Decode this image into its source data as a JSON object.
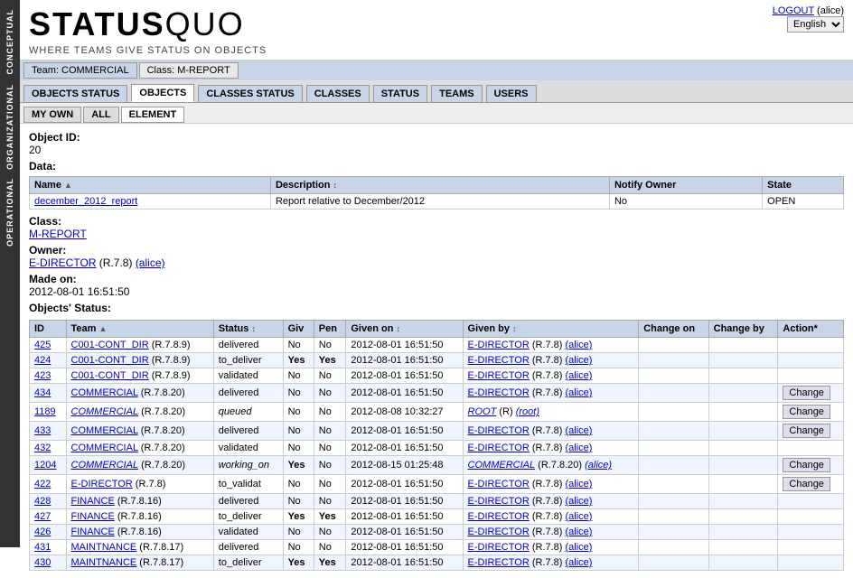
{
  "sidebar": {
    "labels": [
      "CONCEPTUAL",
      "ORGANIZATIONAL",
      "OPERATIONAL"
    ]
  },
  "header": {
    "logo_status": "STATUS",
    "logo_quo": "QUO",
    "tagline": "WHERE TEAMS GIVE STATUS ON OBJECTS",
    "logout_text": "LOGOUT",
    "logout_user": "(alice)",
    "lang_options": [
      "English"
    ],
    "lang_selected": "English"
  },
  "team_class_bar": {
    "team_label": "Team: COMMERCIAL",
    "class_label": "Class: M-REPORT"
  },
  "nav_tabs": [
    {
      "label": "OBJECTS STATUS",
      "active": false
    },
    {
      "label": "OBJECTS",
      "active": true
    },
    {
      "label": "CLASSES STATUS",
      "active": false
    },
    {
      "label": "CLASSES",
      "active": false
    },
    {
      "label": "STATUS",
      "active": false
    },
    {
      "label": "TEAMS",
      "active": false
    },
    {
      "label": "USERS",
      "active": false
    }
  ],
  "sub_tabs": [
    {
      "label": "MY OWN",
      "active": false
    },
    {
      "label": "ALL",
      "active": false
    },
    {
      "label": "ELEMENT",
      "active": true
    }
  ],
  "object": {
    "id_label": "Object ID:",
    "id_value": "20",
    "data_label": "Data:",
    "table_headers": [
      "Name",
      "Description",
      "Notify Owner",
      "State"
    ],
    "table_rows": [
      {
        "name": "december_2012_report",
        "description": "Report relative to December/2012",
        "notify_owner": "No",
        "state": "OPEN"
      }
    ],
    "class_label": "Class:",
    "class_value": "M-REPORT",
    "owner_label": "Owner:",
    "owner_value": "E-DIRECTOR",
    "owner_version": "(R.7.8)",
    "owner_user": "(alice)",
    "made_on_label": "Made on:",
    "made_on_value": "2012-08-01 16:51:50",
    "objects_status_label": "Objects' Status:"
  },
  "status_table": {
    "headers": [
      "ID",
      "Team",
      "Status",
      "Giv",
      "Pen",
      "Given on",
      "Given by",
      "Change on",
      "Change by",
      "Action*"
    ],
    "rows": [
      {
        "id": "425",
        "team": "C001-CONT_DIR",
        "team_version": "(R.7.8.9)",
        "status": "delivered",
        "giv": "No",
        "pen": "No",
        "given_on": "2012-08-01 16:51:50",
        "given_by": "E-DIRECTOR",
        "given_by_version": "(R.7.8)",
        "given_by_user": "(alice)",
        "change_on": "",
        "change_by": "",
        "action": "",
        "italic": false
      },
      {
        "id": "424",
        "team": "C001-CONT_DIR",
        "team_version": "(R.7.8.9)",
        "status": "to_deliver",
        "giv": "Yes",
        "pen": "Yes",
        "given_on": "2012-08-01 16:51:50",
        "given_by": "E-DIRECTOR",
        "given_by_version": "(R.7.8)",
        "given_by_user": "(alice)",
        "change_on": "",
        "change_by": "",
        "action": "",
        "italic": false
      },
      {
        "id": "423",
        "team": "C001-CONT_DIR",
        "team_version": "(R.7.8.9)",
        "status": "validated",
        "giv": "No",
        "pen": "No",
        "given_on": "2012-08-01 16:51:50",
        "given_by": "E-DIRECTOR",
        "given_by_version": "(R.7.8)",
        "given_by_user": "(alice)",
        "change_on": "",
        "change_by": "",
        "action": "",
        "italic": false
      },
      {
        "id": "434",
        "team": "COMMERCIAL",
        "team_version": "(R.7.8.20)",
        "status": "delivered",
        "giv": "No",
        "pen": "No",
        "given_on": "2012-08-01 16:51:50",
        "given_by": "E-DIRECTOR",
        "given_by_version": "(R.7.8)",
        "given_by_user": "(alice)",
        "change_on": "",
        "change_by": "",
        "action": "Change",
        "italic": false
      },
      {
        "id": "1189",
        "team": "COMMERCIAL",
        "team_version": "(R.7.8.20)",
        "status": "queued",
        "giv": "No",
        "pen": "No",
        "given_on": "2012-08-08 10:32:27",
        "given_by": "ROOT",
        "given_by_version": "(R)",
        "given_by_user": "(root)",
        "change_on": "",
        "change_by": "",
        "action": "Change",
        "italic": true
      },
      {
        "id": "433",
        "team": "COMMERCIAL",
        "team_version": "(R.7.8.20)",
        "status": "delivered",
        "giv": "No",
        "pen": "No",
        "given_on": "2012-08-01 16:51:50",
        "given_by": "E-DIRECTOR",
        "given_by_version": "(R.7.8)",
        "given_by_user": "(alice)",
        "change_on": "",
        "change_by": "",
        "action": "Change",
        "italic": false
      },
      {
        "id": "432",
        "team": "COMMERCIAL",
        "team_version": "(R.7.8.20)",
        "status": "validated",
        "giv": "No",
        "pen": "No",
        "given_on": "2012-08-01 16:51:50",
        "given_by": "E-DIRECTOR",
        "given_by_version": "(R.7.8)",
        "given_by_user": "(alice)",
        "change_on": "",
        "change_by": "",
        "action": "",
        "italic": false
      },
      {
        "id": "1204",
        "team": "COMMERCIAL",
        "team_version": "(R.7.8.20)",
        "status": "working_on",
        "giv": "Yes",
        "pen": "No",
        "given_on": "2012-08-15 01:25:48",
        "given_by": "COMMERCIAL",
        "given_by_version": "(R.7.8.20)",
        "given_by_user": "(alice)",
        "change_on": "",
        "change_by": "",
        "action": "Change",
        "italic": true
      },
      {
        "id": "422",
        "team": "E-DIRECTOR",
        "team_version": "(R.7.8)",
        "status": "to_validat",
        "giv": "No",
        "pen": "No",
        "given_on": "2012-08-01 16:51:50",
        "given_by": "E-DIRECTOR",
        "given_by_version": "(R.7.8)",
        "given_by_user": "(alice)",
        "change_on": "",
        "change_by": "",
        "action": "Change",
        "italic": false
      },
      {
        "id": "428",
        "team": "FINANCE",
        "team_version": "(R.7.8.16)",
        "status": "delivered",
        "giv": "No",
        "pen": "No",
        "given_on": "2012-08-01 16:51:50",
        "given_by": "E-DIRECTOR",
        "given_by_version": "(R.7.8)",
        "given_by_user": "(alice)",
        "change_on": "",
        "change_by": "",
        "action": "",
        "italic": false
      },
      {
        "id": "427",
        "team": "FINANCE",
        "team_version": "(R.7.8.16)",
        "status": "to_deliver",
        "giv": "Yes",
        "pen": "Yes",
        "given_on": "2012-08-01 16:51:50",
        "given_by": "E-DIRECTOR",
        "given_by_version": "(R.7.8)",
        "given_by_user": "(alice)",
        "change_on": "",
        "change_by": "",
        "action": "",
        "italic": false
      },
      {
        "id": "426",
        "team": "FINANCE",
        "team_version": "(R.7.8.16)",
        "status": "validated",
        "giv": "No",
        "pen": "No",
        "given_on": "2012-08-01 16:51:50",
        "given_by": "E-DIRECTOR",
        "given_by_version": "(R.7.8)",
        "given_by_user": "(alice)",
        "change_on": "",
        "change_by": "",
        "action": "",
        "italic": false
      },
      {
        "id": "431",
        "team": "MAINTNANCE",
        "team_version": "(R.7.8.17)",
        "status": "delivered",
        "giv": "No",
        "pen": "No",
        "given_on": "2012-08-01 16:51:50",
        "given_by": "E-DIRECTOR",
        "given_by_version": "(R.7.8)",
        "given_by_user": "(alice)",
        "change_on": "",
        "change_by": "",
        "action": "",
        "italic": false
      },
      {
        "id": "430",
        "team": "MAINTNANCE",
        "team_version": "(R.7.8.17)",
        "status": "to_deliver",
        "giv": "Yes",
        "pen": "Yes",
        "given_on": "2012-08-01 16:51:50",
        "given_by": "E-DIRECTOR",
        "given_by_version": "(R.7.8)",
        "given_by_user": "(alice)",
        "change_on": "",
        "change_by": "",
        "action": "",
        "italic": false
      }
    ]
  }
}
